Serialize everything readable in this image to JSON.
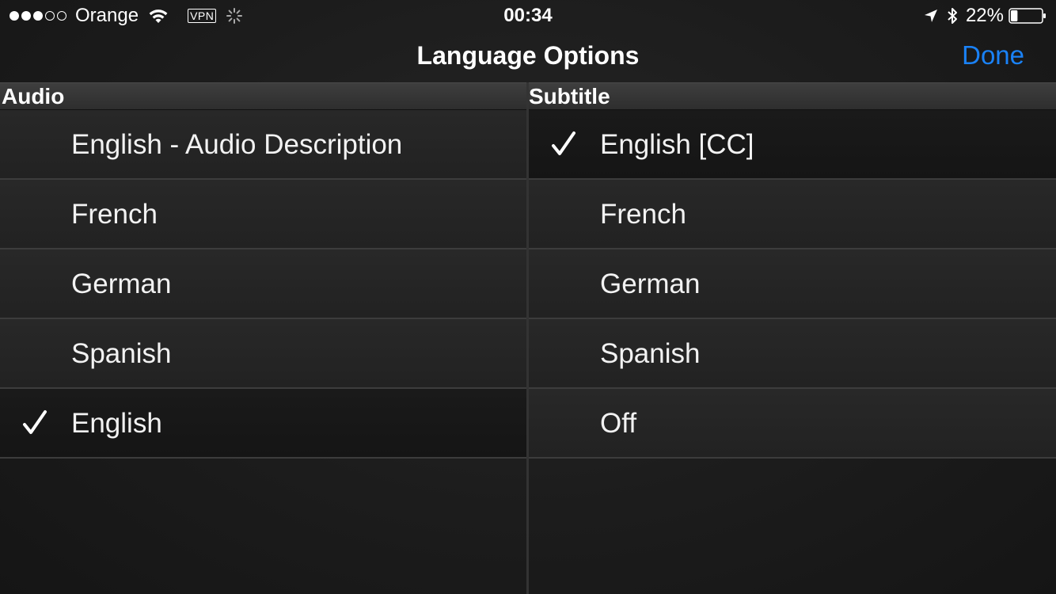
{
  "status_bar": {
    "signal_strength": 3,
    "signal_max": 5,
    "carrier": "Orange",
    "vpn_label": "VPN",
    "time": "00:34",
    "battery_percent_label": "22%",
    "battery_level": 0.22,
    "icons": [
      "wifi-icon",
      "activity-spinner-icon",
      "location-arrow-icon",
      "bluetooth-icon",
      "battery-icon"
    ]
  },
  "nav": {
    "title": "Language Options",
    "done_label": "Done",
    "accent_color": "#1a82f7"
  },
  "audio": {
    "header": "Audio",
    "items": [
      {
        "label": "English - Audio Description",
        "selected": false
      },
      {
        "label": "French",
        "selected": false
      },
      {
        "label": "German",
        "selected": false
      },
      {
        "label": "Spanish",
        "selected": false
      },
      {
        "label": "English",
        "selected": true
      }
    ]
  },
  "subtitle": {
    "header": "Subtitle",
    "items": [
      {
        "label": "English [CC]",
        "selected": true
      },
      {
        "label": "French",
        "selected": false
      },
      {
        "label": "German",
        "selected": false
      },
      {
        "label": "Spanish",
        "selected": false
      },
      {
        "label": "Off",
        "selected": false
      }
    ]
  }
}
